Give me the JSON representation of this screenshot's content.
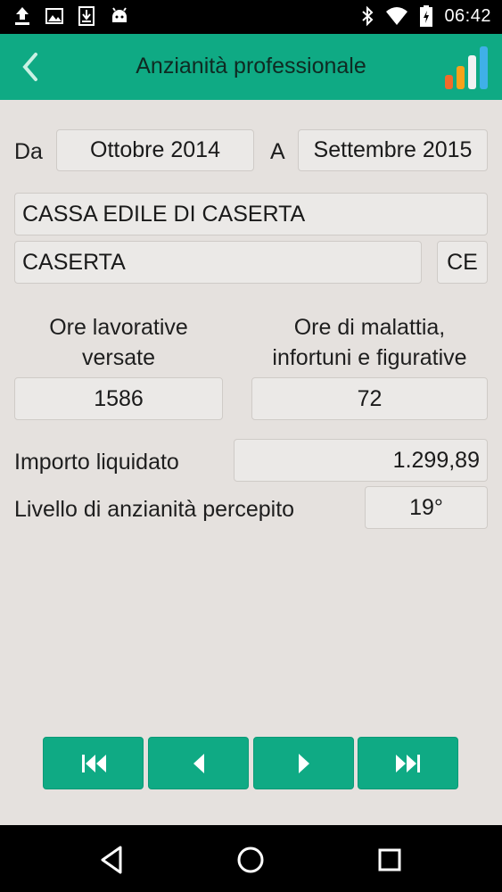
{
  "status_bar": {
    "time": "06:42",
    "left_icons": [
      "upload-icon",
      "image-icon",
      "download-icon",
      "android-icon"
    ],
    "right_icons": [
      "bluetooth-icon",
      "wifi-icon",
      "battery-charging-icon"
    ]
  },
  "app_bar": {
    "title": "Anzianità professionale",
    "back_icon": "chevron-left-icon",
    "logo_icon": "bar-chart-logo-icon",
    "color": "#0faa84"
  },
  "period": {
    "from_label": "Da",
    "from_value": "Ottobre 2014",
    "to_label": "A",
    "to_value": "Settembre 2015"
  },
  "cassa": {
    "name": "CASSA EDILE DI CASERTA",
    "city": "CASERTA",
    "province": "CE"
  },
  "hours": {
    "worked_label_line1": "Ore lavorative",
    "worked_label_line2": "versate",
    "worked_value": "1586",
    "sick_label_line1": "Ore di malattia,",
    "sick_label_line2": "infortuni e figurative",
    "sick_value": "72"
  },
  "amount": {
    "label": "Importo liquidato",
    "value": "1.299,89"
  },
  "level": {
    "label": "Livello di anzianità percepito",
    "value": "19°"
  },
  "navigation": {
    "buttons": [
      "first-page-icon",
      "previous-page-icon",
      "next-page-icon",
      "last-page-icon"
    ]
  },
  "system_nav": {
    "buttons": [
      "back-triangle-icon",
      "home-circle-icon",
      "recents-square-icon"
    ]
  }
}
